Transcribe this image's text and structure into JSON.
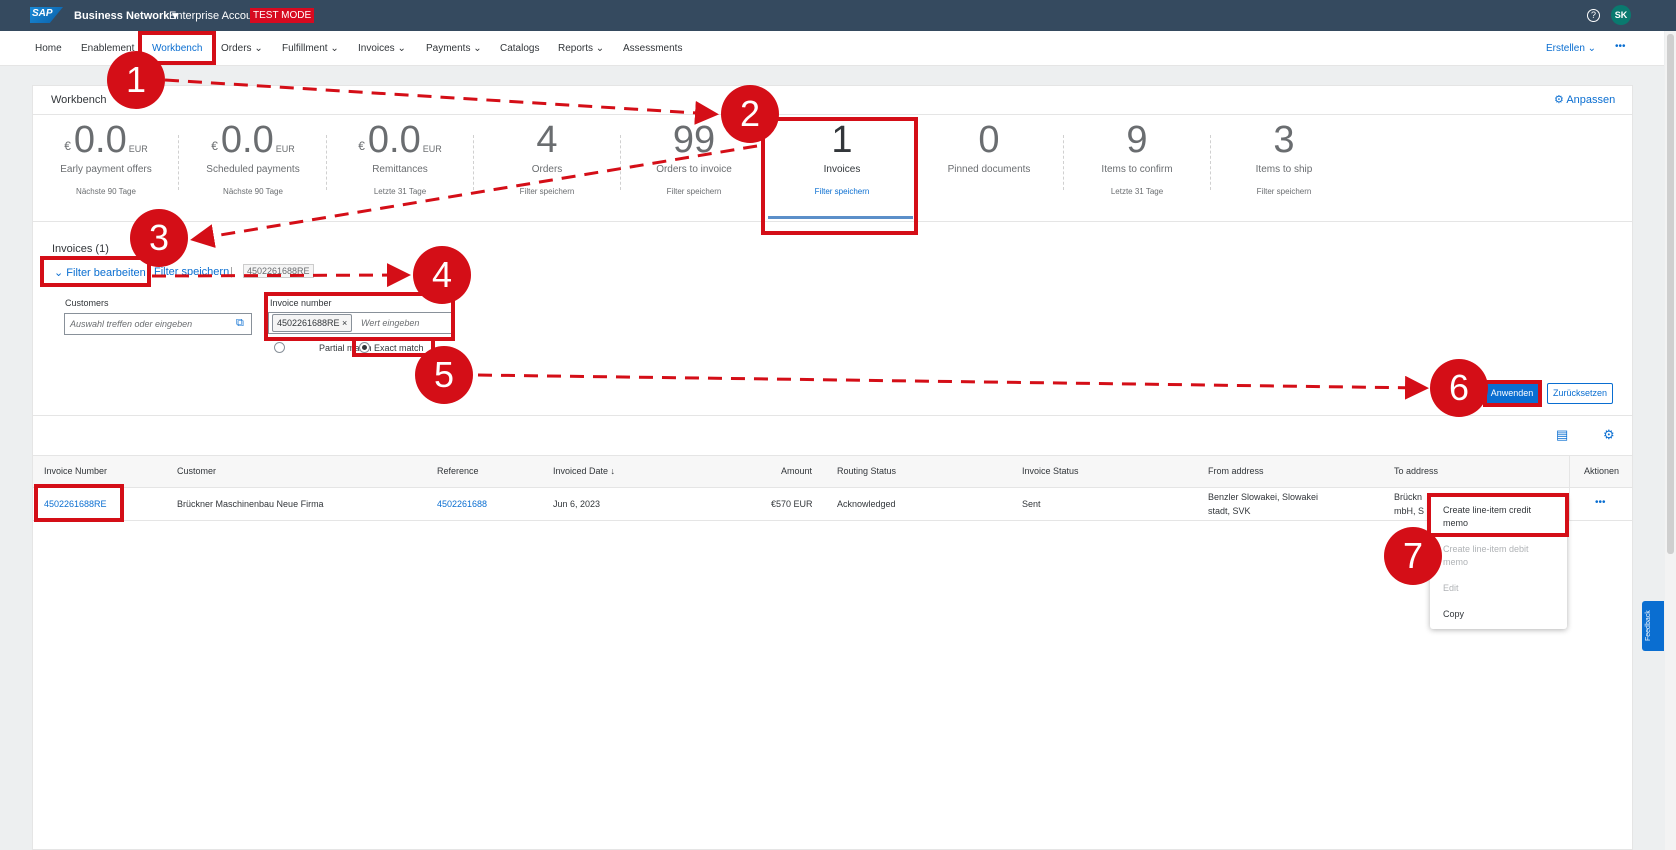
{
  "topbar": {
    "logo": "SAP",
    "network": "Business Network ▾",
    "account": "Enterprise Account",
    "test_mode": "TEST MODE",
    "help": "?",
    "avatar": "SK"
  },
  "nav": {
    "items": [
      "Home",
      "Enablement",
      "Workbench",
      "Orders ⌄",
      "Fulfillment ⌄",
      "Invoices ⌄",
      "Payments ⌄",
      "Catalogs",
      "Reports ⌄",
      "Assessments"
    ],
    "active": "Workbench",
    "create": "Erstellen ⌄",
    "more": "•••"
  },
  "workbench": {
    "title": "Workbench",
    "customize": "Anpassen"
  },
  "tiles": [
    {
      "currency": "€",
      "value": "0.0",
      "unit": "EUR",
      "label": "Early payment offers",
      "sub": "Nächste 90 Tage"
    },
    {
      "currency": "€",
      "value": "0.0",
      "unit": "EUR",
      "label": "Scheduled payments",
      "sub": "Nächste 90 Tage"
    },
    {
      "currency": "€",
      "value": "0.0",
      "unit": "EUR",
      "label": "Remittances",
      "sub": "Letzte 31 Tage"
    },
    {
      "value": "4",
      "label": "Orders",
      "sub": "Filter speichern"
    },
    {
      "value": "99",
      "label": "Orders to invoice",
      "sub": "Filter speichern"
    },
    {
      "value": "1",
      "label": "Invoices",
      "sub": "Filter speichern"
    },
    {
      "value": "0",
      "label": "Pinned documents",
      "sub": ""
    },
    {
      "value": "9",
      "label": "Items to confirm",
      "sub": "Letzte 31 Tage"
    },
    {
      "value": "3",
      "label": "Items to ship",
      "sub": "Filter speichern"
    }
  ],
  "filter": {
    "title": "Invoices (1)",
    "edit": "Filter bearbeiten",
    "save": "Filter speichern",
    "separator": "|",
    "active_chip": "4502261688RE",
    "customers_label": "Customers",
    "customers_placeholder": "Auswahl treffen oder eingeben",
    "invoice_label": "Invoice number",
    "invoice_token": "4502261688RE ×",
    "invoice_placeholder": "Wert eingeben",
    "partial": "Partial match",
    "exact": "Exact match",
    "apply": "Anwenden",
    "reset": "Zurücksetzen"
  },
  "table": {
    "headers": [
      "Invoice Number",
      "Customer",
      "Reference",
      "Invoiced Date ↓",
      "Amount",
      "Routing Status",
      "Invoice Status",
      "From address",
      "To address",
      "Aktionen"
    ],
    "row": {
      "invoice_number": "4502261688RE",
      "customer": "Brückner Maschinenbau Neue Firma",
      "reference": "4502261688",
      "date": "Jun 6, 2023",
      "amount": "€570 EUR",
      "routing": "Acknowledged",
      "status": "Sent",
      "from_1": "Benzler Slowakei, Slowakei",
      "from_2": "stadt, SVK",
      "to_1": "Brückn",
      "to_2": "mbH, S",
      "actions": "•••"
    }
  },
  "menu": {
    "credit_1": "Create line-item credit",
    "credit_2": "memo",
    "debit_1": "Create line-item debit",
    "debit_2": "memo",
    "edit": "Edit",
    "copy": "Copy"
  },
  "feedback": "Feedback",
  "steps": [
    "1",
    "2",
    "3",
    "4",
    "5",
    "6",
    "7"
  ],
  "colors": {
    "accent": "#0a6ed1",
    "shell": "#354a5f",
    "annotation": "#d40e17",
    "test_mode": "#d70a20"
  }
}
